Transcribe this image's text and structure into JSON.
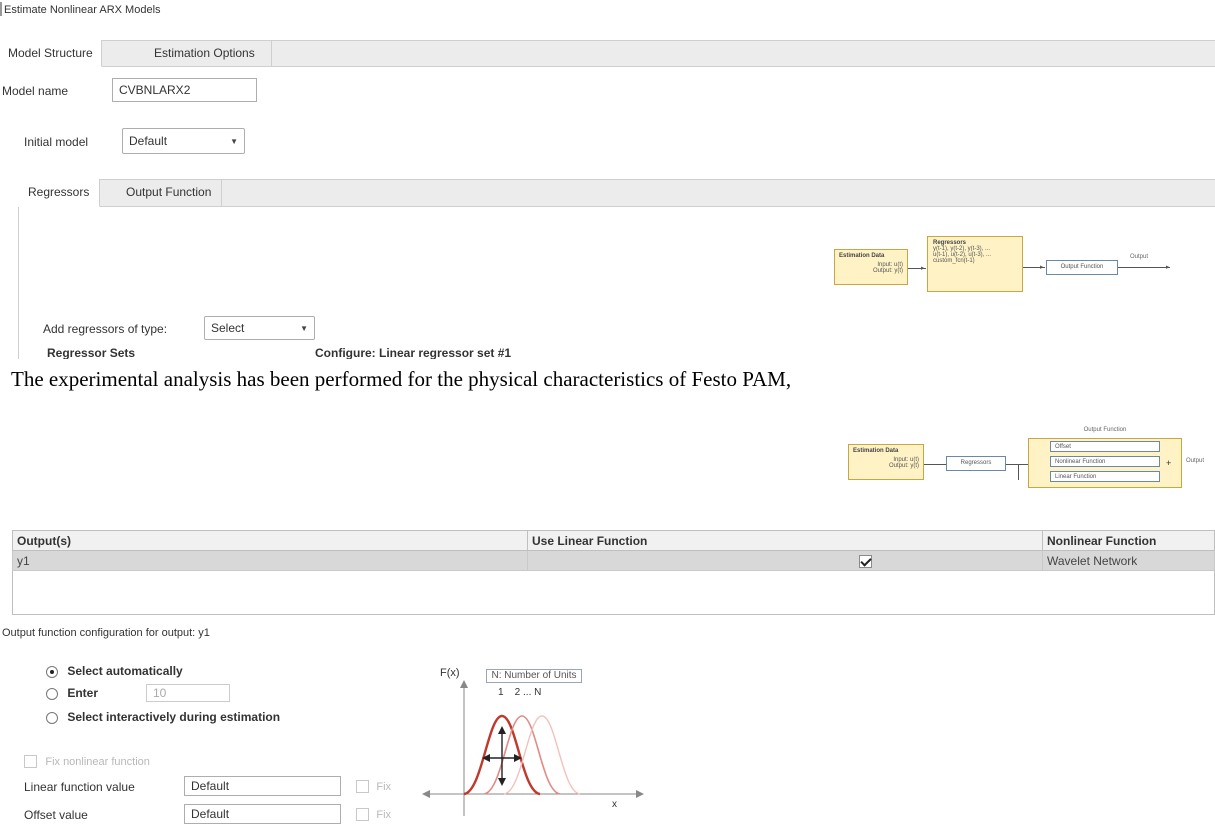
{
  "window": {
    "title": "Estimate Nonlinear ARX Models"
  },
  "tabs": [
    {
      "label": "Model Structure",
      "active": true
    },
    {
      "label": "Estimation Options",
      "active": false
    }
  ],
  "model_name": {
    "label": "Model name",
    "value": "CVBNLARX2"
  },
  "initial_model": {
    "label": "Initial model",
    "value": "Default"
  },
  "inner_tabs": [
    {
      "label": "Regressors",
      "active": true
    },
    {
      "label": "Output Function",
      "active": false
    }
  ],
  "diagram_top": {
    "data_title": "Estimation Data",
    "input": "Input: u(t)",
    "output": "Output: y(t)",
    "regressors_title": "Regressors",
    "reg_line1": "y(t-1), y(t-2), y(t-3), ...",
    "reg_line2": "u(t-1), u(t-2), u(t-3), ...",
    "reg_line3": "custom_fcn(t-1)",
    "output_function": "Output Function",
    "output_label": "Output"
  },
  "add_regressors": {
    "label": "Add regressors of type:",
    "value": "Select"
  },
  "regressor_sets_heading": "Regressor Sets",
  "configure_heading": "Configure: Linear regressor set #1",
  "caption": "The experimental analysis has been performed for the physical characteristics of Festo PAM,",
  "diagram_bottom": {
    "data_title": "Estimation Data",
    "input": "Input: u(t)",
    "output": "Output: y(t)",
    "regressors": "Regressors",
    "output_function_title": "Output Function",
    "items": [
      "Offset",
      "Nonlinear Function",
      "Linear Function"
    ],
    "output_label": "Output"
  },
  "table": {
    "headers": [
      "Output(s)",
      "Use Linear Function",
      "Nonlinear Function"
    ],
    "rows": [
      {
        "output": "y1",
        "use_linear": true,
        "nonlinear": "Wavelet Network"
      }
    ]
  },
  "config_title": "Output function configuration for output: y1",
  "options": [
    {
      "label": "Select automatically",
      "selected": true
    },
    {
      "label": "Enter",
      "selected": false,
      "value": "10"
    },
    {
      "label": "Select interactively during estimation",
      "selected": false
    }
  ],
  "fix_nonlinear": "Fix nonlinear function",
  "linear_value": {
    "label": "Linear function value",
    "value": "Default",
    "fix": "Fix"
  },
  "offset_value": {
    "label": "Offset value",
    "value": "Default",
    "fix": "Fix"
  },
  "figure": {
    "y_axis": "F(x)",
    "x_axis": "x",
    "units_note": "N: Number of Units",
    "unit_labels": "1    2 ... N"
  },
  "colors": {
    "tab_bar": "#ececec",
    "diagram_yellow": "#fff3c6",
    "wavelet_red": "#c0392b",
    "row_selected": "#d8d8d8"
  }
}
